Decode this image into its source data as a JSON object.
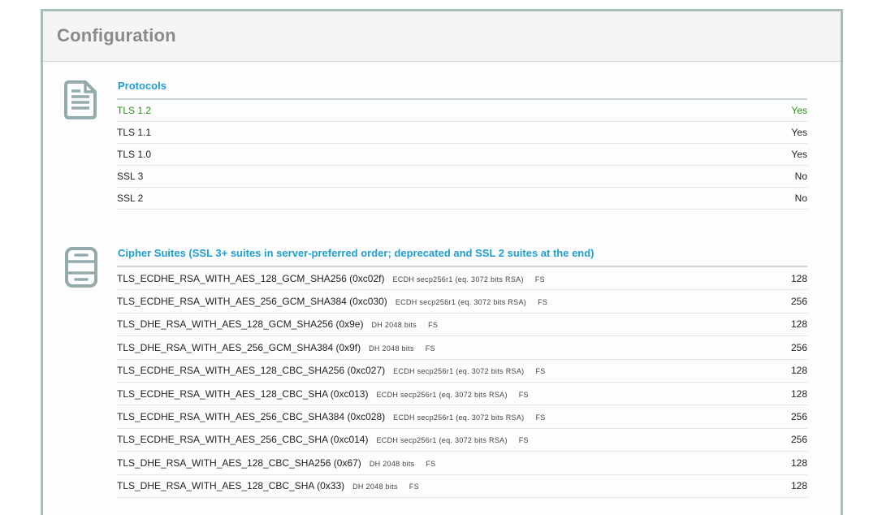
{
  "panel": {
    "title": "Configuration"
  },
  "protocols": {
    "title": "Protocols",
    "rows": [
      {
        "name": "TLS 1.2",
        "value": "Yes",
        "highlight": true
      },
      {
        "name": "TLS 1.1",
        "value": "Yes",
        "highlight": false
      },
      {
        "name": "TLS 1.0",
        "value": "Yes",
        "highlight": false
      },
      {
        "name": "SSL 3",
        "value": "No",
        "highlight": false
      },
      {
        "name": "SSL 2",
        "value": "No",
        "highlight": false
      }
    ]
  },
  "ciphers": {
    "title": "Cipher Suites (SSL 3+ suites in server-preferred order; deprecated and SSL 2 suites at the end)",
    "rows": [
      {
        "name": "TLS_ECDHE_RSA_WITH_AES_128_GCM_SHA256 (0xc02f)",
        "kex": "ECDH secp256r1 (eq. 3072 bits RSA)",
        "fs": "FS",
        "bits": "128"
      },
      {
        "name": "TLS_ECDHE_RSA_WITH_AES_256_GCM_SHA384 (0xc030)",
        "kex": "ECDH secp256r1 (eq. 3072 bits RSA)",
        "fs": "FS",
        "bits": "256"
      },
      {
        "name": "TLS_DHE_RSA_WITH_AES_128_GCM_SHA256 (0x9e)",
        "kex": "DH 2048 bits",
        "fs": "FS",
        "bits": "128"
      },
      {
        "name": "TLS_DHE_RSA_WITH_AES_256_GCM_SHA384 (0x9f)",
        "kex": "DH 2048 bits",
        "fs": "FS",
        "bits": "256"
      },
      {
        "name": "TLS_ECDHE_RSA_WITH_AES_128_CBC_SHA256 (0xc027)",
        "kex": "ECDH secp256r1 (eq. 3072 bits RSA)",
        "fs": "FS",
        "bits": "128"
      },
      {
        "name": "TLS_ECDHE_RSA_WITH_AES_128_CBC_SHA (0xc013)",
        "kex": "ECDH secp256r1 (eq. 3072 bits RSA)",
        "fs": "FS",
        "bits": "128"
      },
      {
        "name": "TLS_ECDHE_RSA_WITH_AES_256_CBC_SHA384 (0xc028)",
        "kex": "ECDH secp256r1 (eq. 3072 bits RSA)",
        "fs": "FS",
        "bits": "256"
      },
      {
        "name": "TLS_ECDHE_RSA_WITH_AES_256_CBC_SHA (0xc014)",
        "kex": "ECDH secp256r1 (eq. 3072 bits RSA)",
        "fs": "FS",
        "bits": "256"
      },
      {
        "name": "TLS_DHE_RSA_WITH_AES_128_CBC_SHA256 (0x67)",
        "kex": "DH 2048 bits",
        "fs": "FS",
        "bits": "128"
      },
      {
        "name": "TLS_DHE_RSA_WITH_AES_128_CBC_SHA (0x33)",
        "kex": "DH 2048 bits",
        "fs": "FS",
        "bits": "128"
      }
    ]
  },
  "icons": {
    "protocols": "document-icon",
    "ciphers": "server-icon"
  },
  "colors": {
    "section_title": "#1f9fd0",
    "highlight": "#2a8f1c",
    "panel_border": "#a8bcbc",
    "title": "#8a8a8a"
  }
}
